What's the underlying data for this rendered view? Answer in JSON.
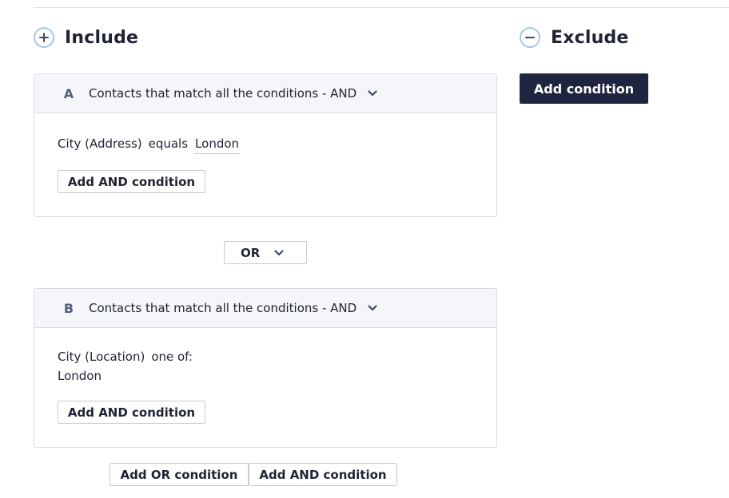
{
  "include": {
    "title": "Include",
    "icon": "plus-circle-icon",
    "groups": [
      {
        "letter": "A",
        "title": "Contacts that match all the conditions - AND",
        "condition": {
          "field": "City (Address)",
          "operator": "equals",
          "value": "London"
        },
        "add_and_label": "Add AND condition"
      },
      {
        "letter": "B",
        "title": "Contacts that match all the conditions - AND",
        "condition": {
          "field": "City (Location)",
          "operator": "one of:",
          "value": "London"
        },
        "add_and_label": "Add AND condition"
      }
    ],
    "connector": {
      "selected": "OR"
    },
    "footer": {
      "add_or_label": "Add OR condition",
      "add_and_label": "Add AND condition"
    }
  },
  "exclude": {
    "title": "Exclude",
    "icon": "minus-circle-icon",
    "add_condition_label": "Add condition"
  },
  "colors": {
    "primary_dark": "#1f2540",
    "circle_border": "#a9c8e6",
    "group_header_bg": "#f5f6f9",
    "border": "#d7dbe1"
  }
}
